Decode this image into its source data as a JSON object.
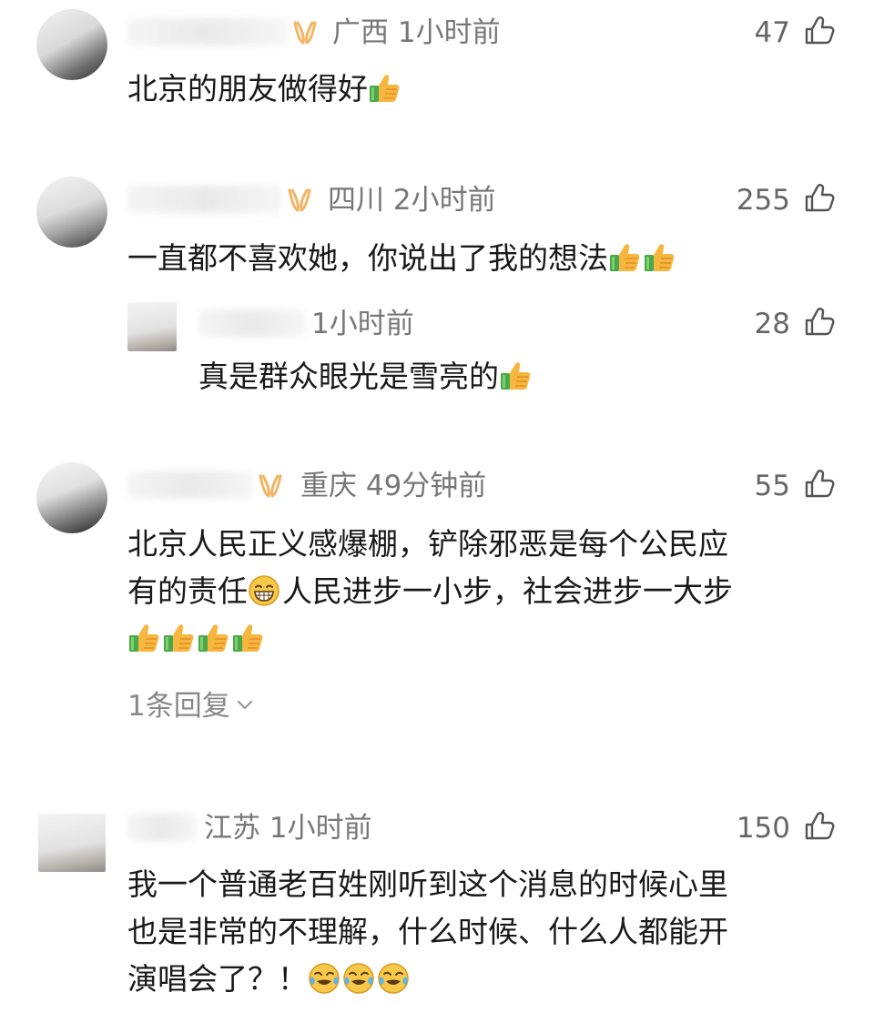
{
  "comments": [
    {
      "region": "广西",
      "time": "1小时前",
      "likes": "47",
      "lines": [
        "北京的朋友做得好"
      ],
      "emoji": [
        [
          "thumbs-up"
        ]
      ]
    },
    {
      "region": "四川",
      "time": "2小时前",
      "likes": "255",
      "lines": [
        "一直都不喜欢她，你说出了我的想法"
      ],
      "emoji": [
        [
          "thumbs-up",
          "thumbs-up"
        ]
      ],
      "reply": {
        "time": "1小时前",
        "likes": "28",
        "text": "真是群众眼光是雪亮的",
        "emoji": [
          "thumbs-up"
        ]
      }
    },
    {
      "region": "重庆",
      "time": "49分钟前",
      "likes": "55",
      "lines": [
        "北京人民正义感爆棚，铲除邪恶是每个公民应",
        "有的责任",
        "人民进步一小步，社会进步一大步"
      ],
      "emoji": [
        "grin",
        "thumbs-up",
        "thumbs-up",
        "thumbs-up",
        "thumbs-up"
      ],
      "replies_label": "1条回复"
    },
    {
      "region": "江苏",
      "time": "1小时前",
      "likes": "150",
      "lines": [
        "我一个普通老百姓刚听到这个消息的时候心里",
        "也是非常的不理解，什么时候、什么人都能开",
        "演唱会了？！"
      ],
      "emoji": [
        "tears-of-joy",
        "tears-of-joy",
        "tears-of-joy"
      ]
    }
  ],
  "icons": {
    "like": "thumb-up-outline-icon",
    "badge": "vip-badge-icon",
    "expand": "chevron-down-icon"
  },
  "colors": {
    "badge": "#f3b463",
    "meta": "#777777",
    "text": "#191919",
    "thumb_skin": "#f6b640",
    "thumb_cuff": "#49a84a"
  }
}
